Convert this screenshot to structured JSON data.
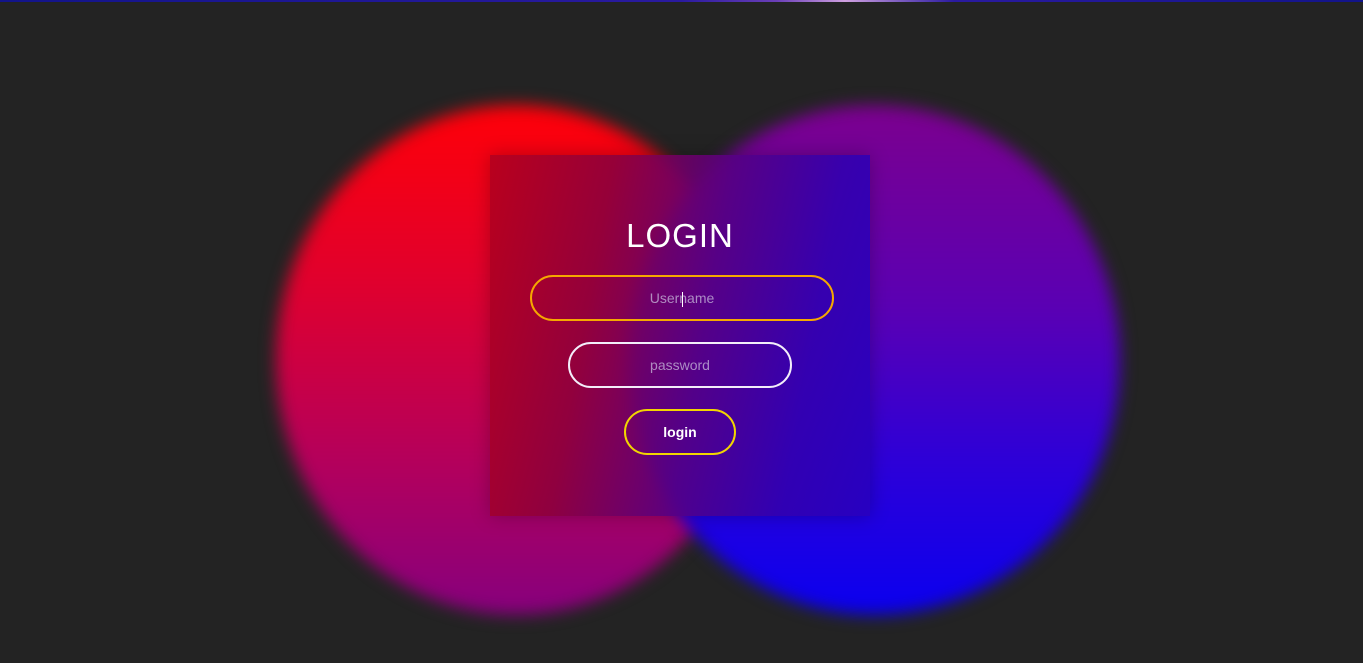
{
  "login_form": {
    "title": "LOGIN",
    "username_placeholder": "Username",
    "password_placeholder": "password",
    "login_button_label": "login"
  },
  "colors": {
    "background": "#232323",
    "username_border": "#f5a800",
    "password_border": "#f3eefa",
    "button_border": "#f2d500",
    "left_orb_top": "#ff0008",
    "left_orb_bottom": "#86007e",
    "right_orb_top": "#7c008e",
    "right_orb_bottom": "#0a00f0"
  }
}
